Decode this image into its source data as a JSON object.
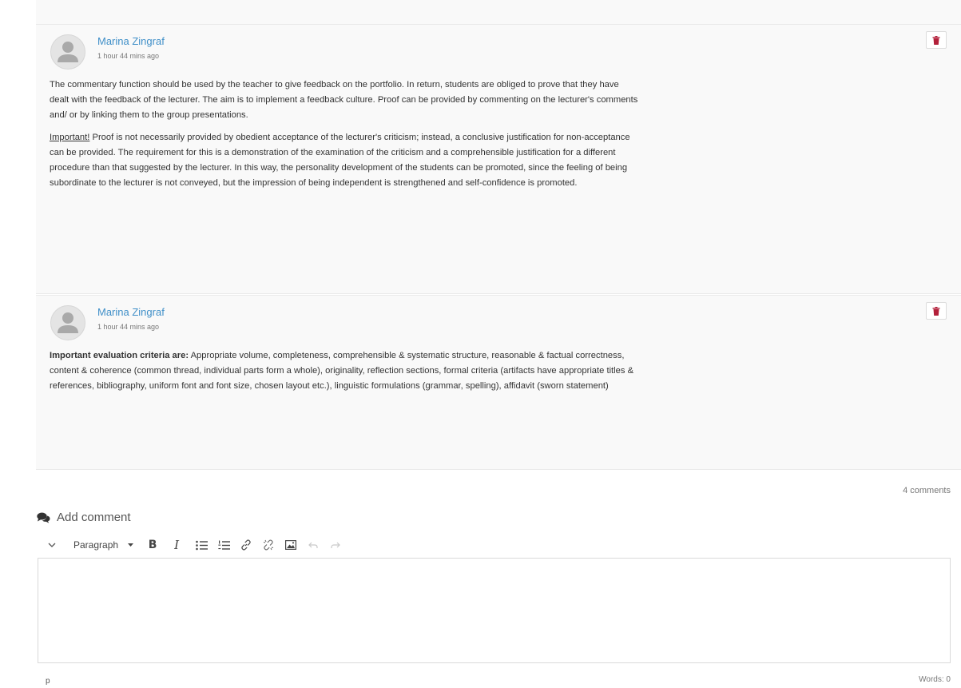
{
  "comments": [
    {
      "author": "Marina Zingraf",
      "time": "1 hour 44 mins ago",
      "paragraphs": [
        "The commentary function should be used by the teacher to give feedback on the portfolio. In return, students are obliged to prove that they have dealt with the feedback of the lecturer. The aim is to implement a feedback culture. Proof can be provided by commenting on the lecturer's comments and/ or by linking them to the group presentations."
      ],
      "important_prefix": "Important!",
      "important_text": " Proof is not necessarily provided by obedient acceptance of the lecturer's criticism; instead, a conclusive justification for non-acceptance can be provided. The requirement for this is a demonstration of the examination of the criticism and a comprehensible justification for a different procedure than that suggested by the lecturer. In this way, the personality development of the students can be promoted, since the feeling of being subordinate to the lecturer is not conveyed, but the impression of being independent is strengthened and self-confidence is promoted."
    },
    {
      "author": "Marina Zingraf",
      "time": "1 hour 44 mins ago",
      "bold_prefix": "Important evaluation criteria are:",
      "text": " Appropriate volume, completeness, comprehensible & systematic structure, reasonable & factual correctness, content & coherence (common thread, individual parts form a whole), originality, reflection sections, formal criteria (artifacts have appropriate titles & references, bibliography, uniform font and font size, chosen layout etc.), linguistic formulations (grammar, spelling), affidavit (sworn statement)"
    }
  ],
  "comment_count": "4 comments",
  "add_comment_label": "Add comment",
  "editor": {
    "format_select": "Paragraph",
    "bold_label": "B",
    "italic_label": "I",
    "path": "p",
    "word_count": "Words: 0"
  },
  "colors": {
    "link": "#3f8fc8",
    "delete_icon": "#b3203a",
    "panel_bg": "#f9f9f9"
  },
  "icons": {
    "add_comment": "comments-icon",
    "delete": "trash-icon",
    "avatar": "user-avatar-icon"
  }
}
